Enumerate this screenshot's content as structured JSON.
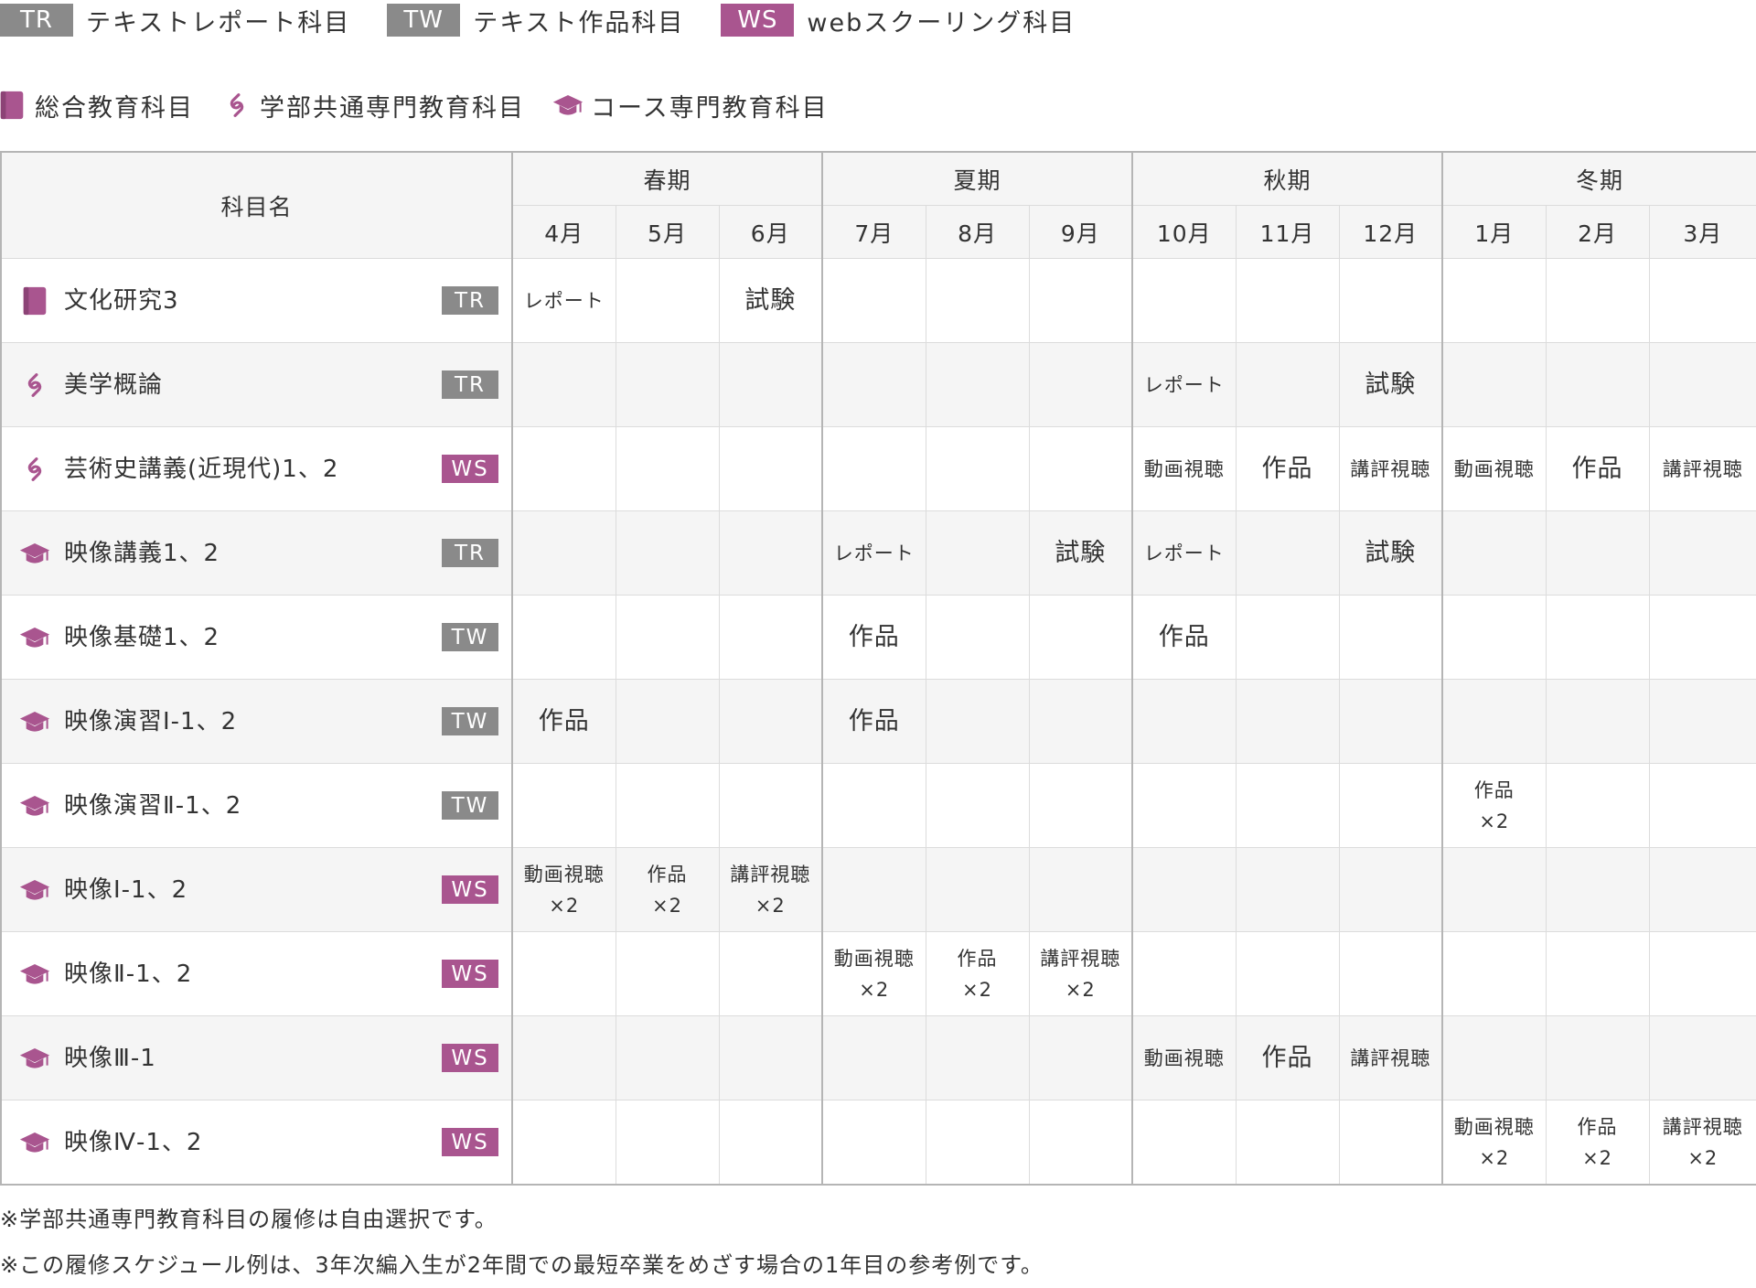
{
  "colors": {
    "tr_badge": "#8a8a8a",
    "tw_badge": "#8a8a8a",
    "ws_badge": "#a9558f",
    "icon_accent": "#a9558f",
    "header_bg": "#f5f5f5"
  },
  "legend": {
    "types": [
      {
        "code": "TR",
        "label": "テキストレポート科目",
        "kind": "tr"
      },
      {
        "code": "TW",
        "label": "テキスト作品科目",
        "kind": "tw"
      },
      {
        "code": "WS",
        "label": "webスクーリング科目",
        "kind": "ws"
      }
    ],
    "categories": [
      {
        "icon": "book-icon",
        "label": "総合教育科目"
      },
      {
        "icon": "link-icon",
        "label": "学部共通専門教育科目"
      },
      {
        "icon": "graduation-cap-icon",
        "label": "コース専門教育科目"
      }
    ]
  },
  "table": {
    "name_header": "科目名",
    "seasons": [
      "春期",
      "夏期",
      "秋期",
      "冬期"
    ],
    "months": [
      "4月",
      "5月",
      "6月",
      "7月",
      "8月",
      "9月",
      "10月",
      "11月",
      "12月",
      "1月",
      "2月",
      "3月"
    ],
    "rows": [
      {
        "icon": "book-icon",
        "name": "文化研究3",
        "type": "TR",
        "cells": [
          [
            "レポート"
          ],
          [],
          [
            "試験"
          ],
          [],
          [],
          [],
          [],
          [],
          [],
          [],
          [],
          []
        ]
      },
      {
        "icon": "link-icon",
        "name": "美学概論",
        "type": "TR",
        "cells": [
          [],
          [],
          [],
          [],
          [],
          [],
          [
            "レポート"
          ],
          [],
          [
            "試験"
          ],
          [],
          [],
          []
        ]
      },
      {
        "icon": "link-icon",
        "name": "芸術史講義(近現代)1、2",
        "type": "WS",
        "cells": [
          [],
          [],
          [],
          [],
          [],
          [],
          [
            "動画視聴"
          ],
          [
            "作品"
          ],
          [
            "講評視聴"
          ],
          [
            "動画視聴"
          ],
          [
            "作品"
          ],
          [
            "講評視聴"
          ]
        ]
      },
      {
        "icon": "graduation-cap-icon",
        "name": "映像講義1、2",
        "type": "TR",
        "cells": [
          [],
          [],
          [],
          [
            "レポート"
          ],
          [],
          [
            "試験"
          ],
          [
            "レポート"
          ],
          [],
          [
            "試験"
          ],
          [],
          [],
          []
        ]
      },
      {
        "icon": "graduation-cap-icon",
        "name": "映像基礎1、2",
        "type": "TW",
        "cells": [
          [],
          [],
          [],
          [
            "作品"
          ],
          [],
          [],
          [
            "作品"
          ],
          [],
          [],
          [],
          [],
          []
        ]
      },
      {
        "icon": "graduation-cap-icon",
        "name": "映像演習Ⅰ-1、2",
        "type": "TW",
        "cells": [
          [
            "作品"
          ],
          [],
          [],
          [
            "作品"
          ],
          [],
          [],
          [],
          [],
          [],
          [],
          [],
          []
        ]
      },
      {
        "icon": "graduation-cap-icon",
        "name": "映像演習Ⅱ-1、2",
        "type": "TW",
        "cells": [
          [],
          [],
          [],
          [],
          [],
          [],
          [],
          [],
          [],
          [
            "作品",
            "×2"
          ],
          [],
          []
        ]
      },
      {
        "icon": "graduation-cap-icon",
        "name": "映像Ⅰ-1、2",
        "type": "WS",
        "cells": [
          [
            "動画視聴",
            "×2"
          ],
          [
            "作品",
            "×2"
          ],
          [
            "講評視聴",
            "×2"
          ],
          [],
          [],
          [],
          [],
          [],
          [],
          [],
          [],
          []
        ]
      },
      {
        "icon": "graduation-cap-icon",
        "name": "映像Ⅱ-1、2",
        "type": "WS",
        "cells": [
          [],
          [],
          [],
          [
            "動画視聴",
            "×2"
          ],
          [
            "作品",
            "×2"
          ],
          [
            "講評視聴",
            "×2"
          ],
          [],
          [],
          [],
          [],
          [],
          []
        ]
      },
      {
        "icon": "graduation-cap-icon",
        "name": "映像Ⅲ-1",
        "type": "WS",
        "cells": [
          [],
          [],
          [],
          [],
          [],
          [],
          [
            "動画視聴"
          ],
          [
            "作品"
          ],
          [
            "講評視聴"
          ],
          [],
          [],
          []
        ]
      },
      {
        "icon": "graduation-cap-icon",
        "name": "映像Ⅳ-1、2",
        "type": "WS",
        "cells": [
          [],
          [],
          [],
          [],
          [],
          [],
          [],
          [],
          [],
          [
            "動画視聴",
            "×2"
          ],
          [
            "作品",
            "×2"
          ],
          [
            "講評視聴",
            "×2"
          ]
        ]
      }
    ]
  },
  "notes": [
    "※学部共通専門教育科目の履修は自由選択です。",
    "※この履修スケジュール例は、3年次編入生が2年間での最短卒業をめざす場合の1年目の参考例です。"
  ]
}
